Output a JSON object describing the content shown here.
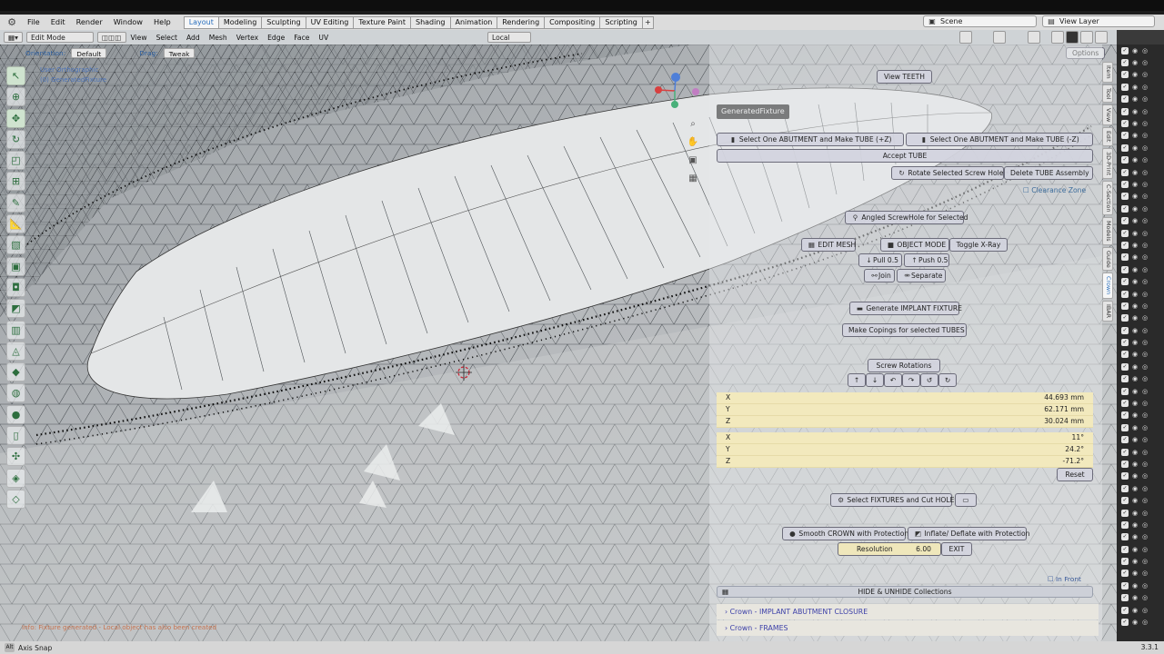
{
  "menubar": {
    "items": [
      "File",
      "Edit",
      "Render",
      "Window",
      "Help"
    ],
    "workspaces": [
      "Layout",
      "Modeling",
      "Sculpting",
      "UV Editing",
      "Texture Paint",
      "Shading",
      "Animation",
      "Rendering",
      "Compositing",
      "Scripting"
    ],
    "active_workspace": "Layout",
    "add_tab": "+",
    "scene": "Scene",
    "view_layer": "View Layer"
  },
  "viewport_header": {
    "mode": "Edit Mode",
    "menus": [
      "View",
      "Select",
      "Add",
      "Mesh",
      "Vertex",
      "Edge",
      "Face",
      "UV"
    ],
    "transform_orientation": "Local"
  },
  "overlay": {
    "orientation_label": "Orientation:",
    "orientation_value": "Default",
    "drag_label": "Drag:",
    "drag_value": "Tweak",
    "options_label": "Options",
    "info_lines": [
      "User Orthographic",
      "(0) GeneratedFixture"
    ],
    "gizmo_tooltip": "GeneratedFixture",
    "warning": "Info: Fixture generated - Local object has also been created"
  },
  "toolbar": {
    "tools": [
      "select-box-icon",
      "cursor-icon",
      "move-icon",
      "rotate-icon",
      "scale-icon",
      "transform-icon",
      "annotate-icon",
      "measure-icon",
      "add-cube-icon",
      "extrude-icon",
      "inset-icon",
      "bevel-icon",
      "loop-cut-icon",
      "knife-icon",
      "poly-build-icon",
      "spin-icon",
      "smooth-icon",
      "edge-slide-icon",
      "shrink-fatten-icon",
      "shear-icon",
      "rip-icon"
    ]
  },
  "panel": {
    "view_teeth": "View TEETH",
    "select_abutment_plus": "Select One ABUTMENT and Make TUBE (+Z)",
    "select_abutment_minus": "Select One ABUTMENT and Make TUBE (-Z)",
    "accept_tube": "Accept TUBE",
    "rotate_screw_hole": "Rotate Selected Screw Hole",
    "delete_tube_assembly": "Delete TUBE Assembly",
    "clearance_zone": "Clearance Zone",
    "angled_screwhole": "Angled ScrewHole for Selected",
    "edit_mesh": "EDIT MESH",
    "object_mode": "OBJECT MODE",
    "toggle_xray": "Toggle X-Ray",
    "pull": "Pull 0.5",
    "push": "Push 0.5",
    "join": "Join",
    "separate": "Separate",
    "generate_implant_fixture": "Generate IMPLANT FIXTURE",
    "make_copings": "Make Copings for selected TUBES",
    "screw_rotations": "Screw Rotations",
    "location": [
      {
        "axis": "X",
        "value": "44.693 mm"
      },
      {
        "axis": "Y",
        "value": "62.171 mm"
      },
      {
        "axis": "Z",
        "value": "30.024 mm"
      }
    ],
    "rotation": [
      {
        "axis": "X",
        "value": "11°"
      },
      {
        "axis": "Y",
        "value": "24.2°"
      },
      {
        "axis": "Z",
        "value": "-71.2°"
      }
    ],
    "reset": "Reset",
    "select_fixtures_cut_hole": "Select FIXTURES and Cut HOLE",
    "smooth_crown": "Smooth CROWN with Protection",
    "inflate_deflate": "Inflate/ Deflate with Protection",
    "resolution_label": "Resolution",
    "resolution_value": "6.00",
    "exit": "EXIT",
    "in_front": "In Front",
    "hide_unhide": "HIDE & UNHIDE Collections",
    "collections": [
      "Crown - IMPLANT  ABUTMENT CLOSURE",
      "Crown - FRAMES"
    ]
  },
  "side_tabs": [
    "Item",
    "Tool",
    "View",
    "Edit",
    "3D-Print",
    "C-Section",
    "Models",
    "Guide",
    "Crown",
    "IBAR"
  ],
  "active_side_tab": "Crown",
  "status": {
    "axis_snap": "Axis Snap",
    "version": "3.3.1"
  }
}
